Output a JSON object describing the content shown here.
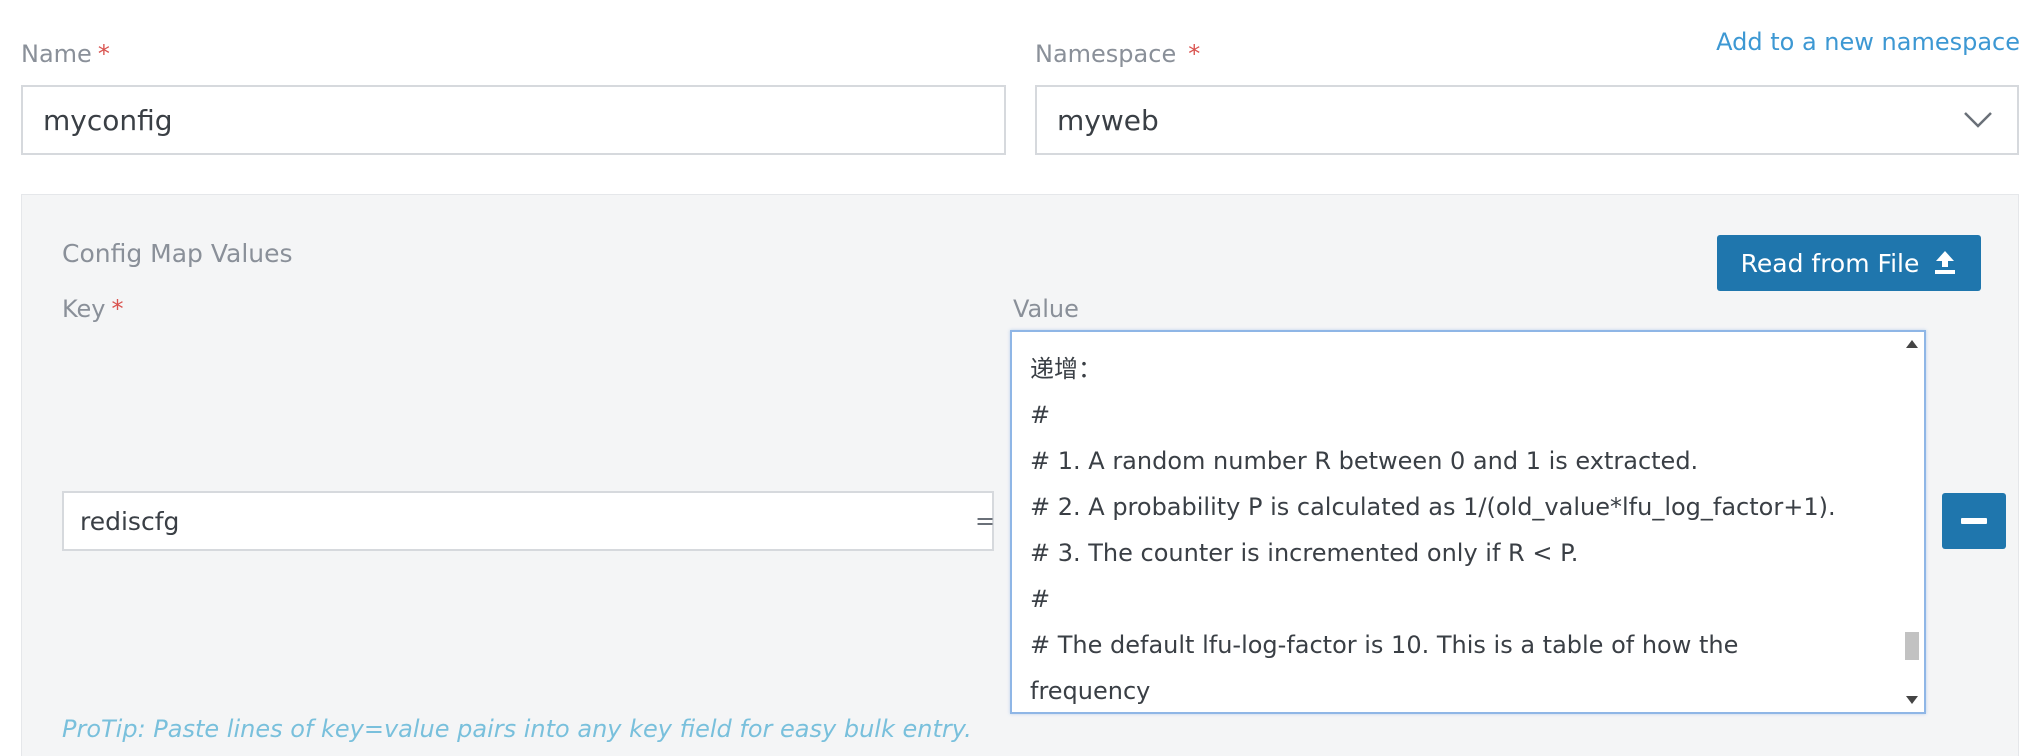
{
  "name_field": {
    "label": "Name",
    "required_mark": "*",
    "value": "myconfig"
  },
  "namespace_field": {
    "label": "Namespace",
    "required_mark": "*",
    "value": "myweb",
    "add_link": "Add to a new namespace"
  },
  "config_map": {
    "title": "Config Map Values",
    "read_file_label": "Read from File",
    "key_label": "Key",
    "key_required_mark": "*",
    "value_label": "Value",
    "entry": {
      "key": "rediscfg",
      "equals": "=",
      "value_lines": [
        "递增：",
        "#",
        "# 1. A random number R between 0 and 1 is extracted.",
        "# 2. A probability P is calculated as 1/(old_value*lfu_log_factor+1).",
        "# 3. The counter is incremented only if R < P.",
        "#",
        "# The default lfu-log-factor is 10. This is a table of how the",
        "frequency"
      ]
    },
    "protip": "ProTip: Paste lines of key=value pairs into any key field for easy bulk entry."
  },
  "colors": {
    "primary_button": "#1f76ad",
    "link": "#3d98d3",
    "required": "#d9534f",
    "protip": "#79c0dc"
  },
  "icons": {
    "namespace_dropdown": "chevron-down-icon",
    "read_file": "upload-icon",
    "remove": "minus-icon"
  }
}
